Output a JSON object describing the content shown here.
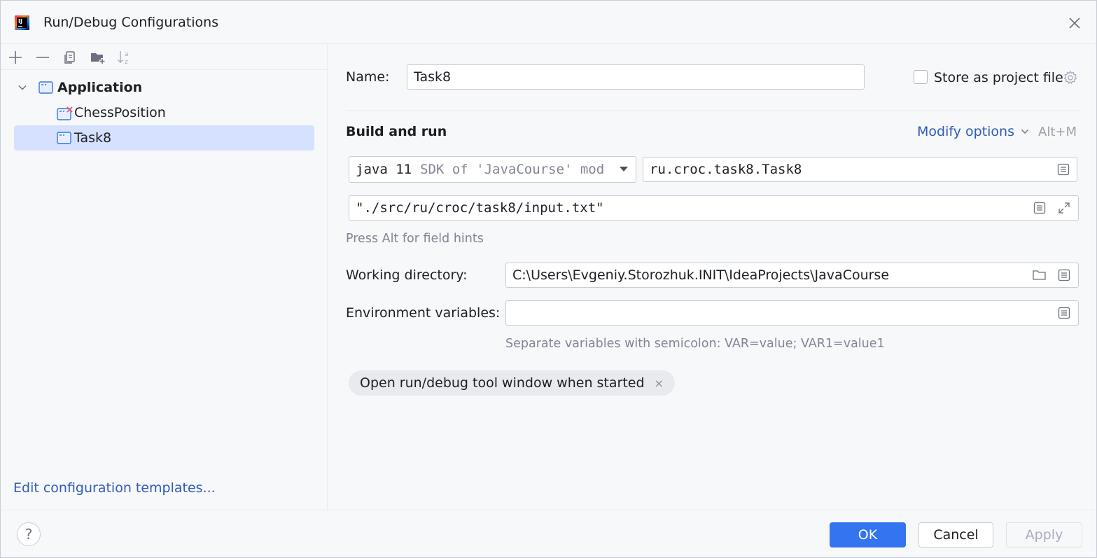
{
  "window": {
    "title": "Run/Debug Configurations"
  },
  "toolbar": {
    "items": [
      "add-icon",
      "remove-icon",
      "copy-icon",
      "new-folder-icon",
      "sort-icon"
    ]
  },
  "tree": {
    "group": "Application",
    "items": [
      {
        "label": "ChessPosition",
        "has_error": true
      },
      {
        "label": "Task8",
        "selected": true
      }
    ]
  },
  "left_footer": {
    "edit_templates": "Edit configuration templates..."
  },
  "form": {
    "name_label": "Name:",
    "name_value": "Task8",
    "store_as_project_file": "Store as project file",
    "store_checked": false,
    "section_title": "Build and run",
    "modify_options": "Modify options",
    "modify_shortcut": "Alt+M",
    "jdk_main": "java 11",
    "jdk_detail": "SDK of 'JavaCourse' mod",
    "main_class": "ru.croc.task8.Task8",
    "program_args": "\"./src/ru/croc/task8/input.txt\"",
    "field_hint": "Press Alt for field hints",
    "working_dir_label": "Working directory:",
    "working_dir_value": "C:\\Users\\Evgeniy.Storozhuk.INIT\\IdeaProjects\\JavaCourse",
    "env_label": "Environment variables:",
    "env_value": "",
    "env_hint": "Separate variables with semicolon: VAR=value; VAR1=value1",
    "chip_label": "Open run/debug tool window when started",
    "chip_close": "×"
  },
  "buttons": {
    "help": "?",
    "ok": "OK",
    "cancel": "Cancel",
    "apply": "Apply"
  },
  "colors": {
    "accent": "#3574f0",
    "link": "#2e5bb8",
    "selection": "#d5e1ff",
    "error": "#e55765"
  }
}
